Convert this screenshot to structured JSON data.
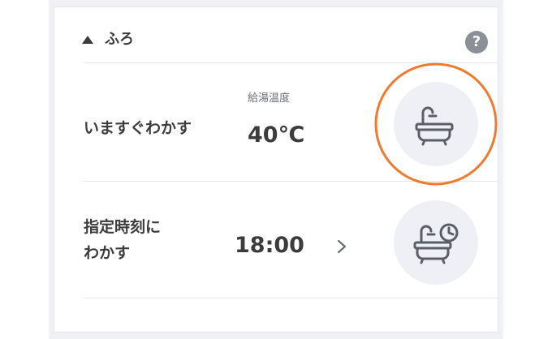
{
  "section": {
    "title": "ふろ"
  },
  "reheat_now": {
    "label": "いますぐわかす",
    "temperature_caption": "給湯温度",
    "temperature_value": "40℃"
  },
  "reheat_at_time": {
    "label_line1": "指定時刻に",
    "label_line2": "わかす",
    "time_value": "18:00"
  },
  "icons": {
    "collapse": "triangle-up-icon",
    "help": "question-icon",
    "bath": "bathtub-icon",
    "bath_timer": "bathtub-clock-icon",
    "next": "chevron-right-icon"
  },
  "colors": {
    "highlight": "#f07a2e",
    "icon_stroke": "#5a5f68"
  }
}
